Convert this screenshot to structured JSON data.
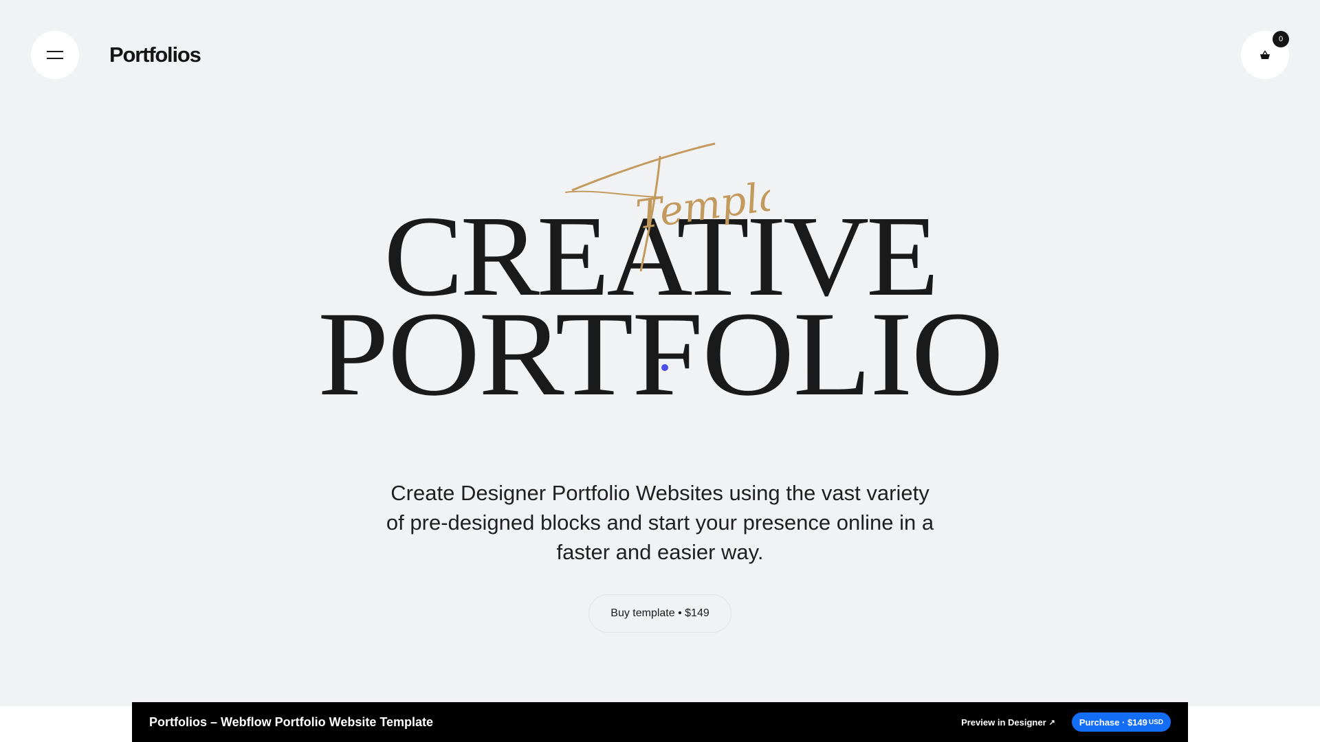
{
  "header": {
    "menu_icon": "hamburger-menu-icon",
    "brand": "Portfolios",
    "cart_icon": "shopping-basket-icon",
    "cart_count": "0"
  },
  "hero": {
    "script_word": "Template",
    "script_color": "#c39a5e",
    "title_line1": "CREATIVE",
    "title_line2": "PORTFOLIO",
    "description": "Create Designer Portfolio Websites using the vast variety of pre-designed blocks and start your presence online in a faster and easier way.",
    "buy_button": "Buy template • $149"
  },
  "webflow_bar": {
    "title": "Portfolios – Webflow Portfolio Website Template",
    "preview_label": "Preview in Designer",
    "preview_icon": "external-arrow-icon",
    "purchase_label": "Purchase · $149",
    "purchase_currency": "USD",
    "purchase_color": "#146ef5"
  }
}
